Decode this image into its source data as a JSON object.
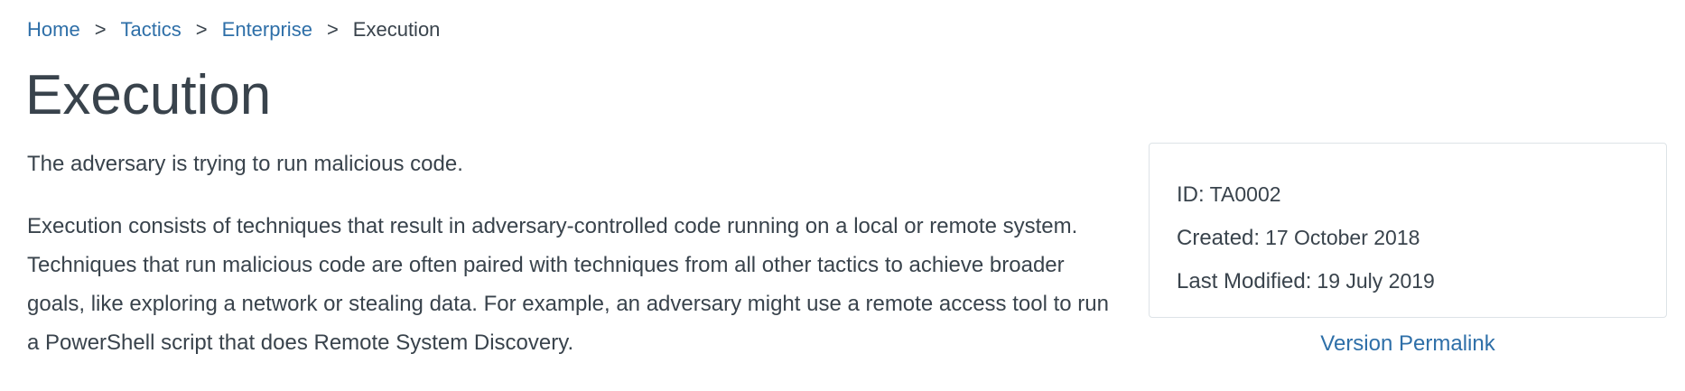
{
  "breadcrumb": {
    "items": [
      "Home",
      "Tactics",
      "Enterprise"
    ],
    "current": "Execution",
    "separator": ">"
  },
  "page": {
    "title": "Execution",
    "summary": "The adversary is trying to run malicious code.",
    "description": "Execution consists of techniques that result in adversary-controlled code running on a local or remote system. Techniques that run malicious code are often paired with techniques from all other tactics to achieve broader goals, like exploring a network or stealing data. For example, an adversary might use a remote access tool to run a PowerShell script that does Remote System Discovery."
  },
  "info_card": {
    "id_label": "ID:",
    "id_value": "TA0002",
    "created_label": "Created:",
    "created_value": "17 October 2018",
    "modified_label": "Last Modified:",
    "modified_value": "19 July 2019"
  },
  "permalink": {
    "label": "Version Permalink"
  },
  "colors": {
    "text": "#39434c",
    "link": "#2e6fa8",
    "card_border": "#dde3e7"
  }
}
